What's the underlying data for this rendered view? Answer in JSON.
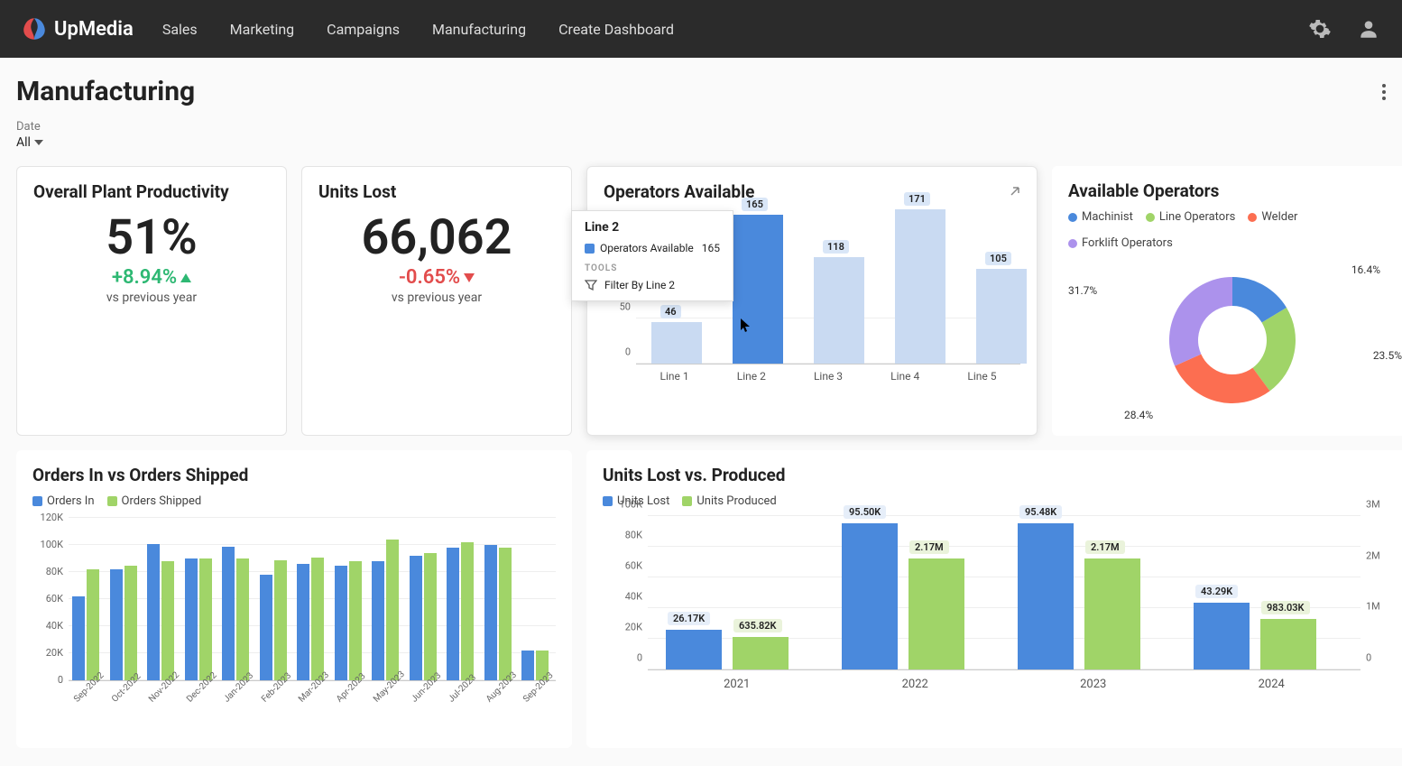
{
  "brand": "UpMedia",
  "nav": [
    "Sales",
    "Marketing",
    "Campaigns",
    "Manufacturing",
    "Create Dashboard"
  ],
  "page_title": "Manufacturing",
  "filter": {
    "label": "Date",
    "value": "All"
  },
  "kpi_productivity": {
    "title": "Overall Plant Productivity",
    "value": "51%",
    "delta": "+8.94%",
    "direction": "up",
    "sub": "vs previous year"
  },
  "kpi_units_lost": {
    "title": "Units Lost",
    "value": "66,062",
    "delta": "-0.65%",
    "direction": "down",
    "sub": "vs previous year"
  },
  "operators_available": {
    "title": "Operators Available",
    "yticks": [
      0,
      50
    ],
    "categories": [
      "Line 1",
      "Line 2",
      "Line 3",
      "Line 4",
      "Line 5"
    ],
    "values": [
      46,
      165,
      118,
      171,
      105
    ],
    "highlight_index": 1,
    "tooltip": {
      "title": "Line 2",
      "series_label": "Operators Available",
      "value": "165",
      "tools_label": "TOOLS",
      "filter_label": "Filter By Line 2"
    }
  },
  "available_operators": {
    "title": "Available Operators",
    "legend": [
      "Machinist",
      "Line Operators",
      "Welder",
      "Forklift Operators"
    ],
    "colors": [
      "#4a89dc",
      "#a0d468",
      "#fc6e51",
      "#ac92ec"
    ],
    "slices": [
      16.4,
      23.5,
      28.4,
      31.7
    ]
  },
  "orders": {
    "title": "Orders In vs Orders Shipped",
    "legend": [
      "Orders In",
      "Orders Shipped"
    ],
    "yticks": [
      "0",
      "20K",
      "40K",
      "60K",
      "80K",
      "100K",
      "120K"
    ],
    "ymax": 120,
    "categories": [
      "Sep-2022",
      "Oct-2022",
      "Nov-2022",
      "Dec-2022",
      "Jan-2023",
      "Feb-2023",
      "Mar-2023",
      "Apr-2023",
      "May-2023",
      "Jun-2023",
      "Jul-2023",
      "Aug-2023",
      "Sep-2023"
    ],
    "series": [
      {
        "name": "Orders In",
        "values": [
          62,
          82,
          101,
          90,
          99,
          78,
          86,
          85,
          88,
          92,
          98,
          100,
          22
        ]
      },
      {
        "name": "Orders Shipped",
        "values": [
          82,
          85,
          88,
          90,
          90,
          89,
          91,
          88,
          104,
          94,
          102,
          98,
          22
        ]
      }
    ]
  },
  "units_lost_produced": {
    "title": "Units Lost vs. Produced",
    "legend": [
      "Units Lost",
      "Units Produced"
    ],
    "left_yticks": [
      "0",
      "20K",
      "40K",
      "60K",
      "80K",
      "100K"
    ],
    "right_yticks": [
      "0",
      "1M",
      "2M",
      "3M"
    ],
    "left_ymax": 100,
    "right_ymax": 3,
    "categories": [
      "2021",
      "2022",
      "2023",
      "2024"
    ],
    "units_lost": {
      "values": [
        26.17,
        95.5,
        95.48,
        43.29
      ],
      "labels": [
        "26.17K",
        "95.50K",
        "95.48K",
        "43.29K"
      ]
    },
    "units_produced": {
      "values": [
        0.63582,
        2.17,
        2.17,
        0.98303
      ],
      "labels": [
        "635.82K",
        "2.17M",
        "2.17M",
        "983.03K"
      ]
    }
  },
  "chart_data": [
    {
      "type": "bar",
      "title": "Operators Available",
      "categories": [
        "Line 1",
        "Line 2",
        "Line 3",
        "Line 4",
        "Line 5"
      ],
      "values": [
        46,
        165,
        118,
        171,
        105
      ],
      "ylim": [
        0,
        180
      ]
    },
    {
      "type": "pie",
      "title": "Available Operators",
      "series": [
        {
          "name": "Machinist",
          "value": 16.4
        },
        {
          "name": "Line Operators",
          "value": 23.5
        },
        {
          "name": "Welder",
          "value": 28.4
        },
        {
          "name": "Forklift Operators",
          "value": 31.7
        }
      ]
    },
    {
      "type": "bar",
      "title": "Orders In vs Orders Shipped",
      "categories": [
        "Sep-2022",
        "Oct-2022",
        "Nov-2022",
        "Dec-2022",
        "Jan-2023",
        "Feb-2023",
        "Mar-2023",
        "Apr-2023",
        "May-2023",
        "Jun-2023",
        "Jul-2023",
        "Aug-2023",
        "Sep-2023"
      ],
      "series": [
        {
          "name": "Orders In",
          "values": [
            62000,
            82000,
            101000,
            90000,
            99000,
            78000,
            86000,
            85000,
            88000,
            92000,
            98000,
            100000,
            22000
          ]
        },
        {
          "name": "Orders Shipped",
          "values": [
            82000,
            85000,
            88000,
            90000,
            90000,
            89000,
            91000,
            88000,
            104000,
            94000,
            102000,
            98000,
            22000
          ]
        }
      ],
      "ylabel": "",
      "ylim": [
        0,
        120000
      ]
    },
    {
      "type": "bar",
      "title": "Units Lost vs. Produced",
      "categories": [
        "2021",
        "2022",
        "2023",
        "2024"
      ],
      "series": [
        {
          "name": "Units Lost",
          "axis": "left",
          "values": [
            26170,
            95500,
            95480,
            43290
          ]
        },
        {
          "name": "Units Produced",
          "axis": "right",
          "values": [
            635820,
            2170000,
            2170000,
            983030
          ]
        }
      ],
      "ylim_left": [
        0,
        100000
      ],
      "ylim_right": [
        0,
        3000000
      ]
    }
  ]
}
